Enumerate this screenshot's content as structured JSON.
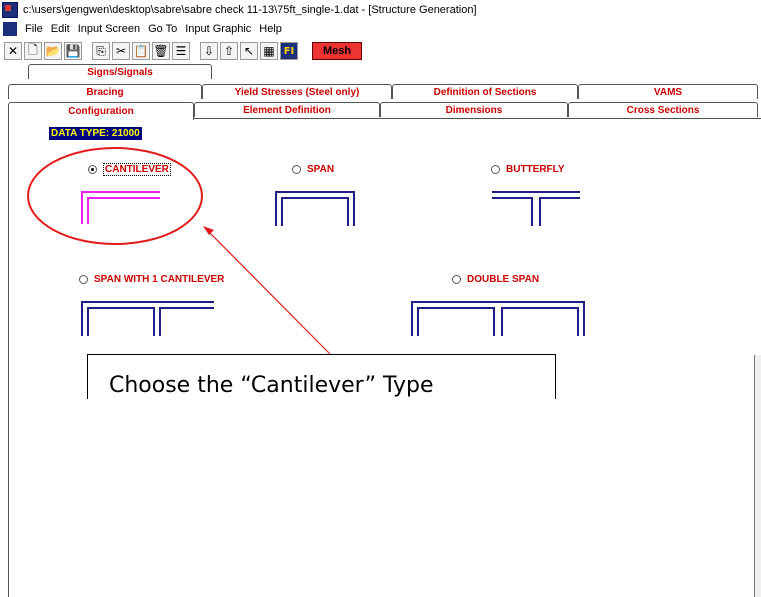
{
  "window": {
    "title": "c:\\users\\gengwen\\desktop\\sabre\\sabre check 11-13\\75ft_single-1.dat - [Structure Generation]"
  },
  "menu": [
    "File",
    "Edit",
    "Input Screen",
    "Go To",
    "Input Graphic",
    "Help"
  ],
  "toolbar": {
    "icons": [
      "close-x",
      "new-file",
      "open-folder",
      "save-disk",
      "copy",
      "cut",
      "paste",
      "delete",
      "sort",
      "arrow-down",
      "arrow-up",
      "pointer-help",
      "grid",
      "fi"
    ],
    "fi_label": "FI",
    "mesh_label": "Mesh"
  },
  "tabs": {
    "row1": [
      "Signs/Signals"
    ],
    "row2": [
      "Bracing",
      "Yield Stresses (Steel only)",
      "Definition of Sections",
      "VAMS"
    ],
    "row3": [
      "Configuration",
      "Element Definition",
      "Dimensions",
      "Cross Sections"
    ],
    "active": "Configuration"
  },
  "panel": {
    "data_type": "DATA TYPE: 21000",
    "options": [
      {
        "label": "CANTILEVER",
        "selected": true
      },
      {
        "label": "SPAN",
        "selected": false
      },
      {
        "label": "BUTTERFLY",
        "selected": false
      },
      {
        "label": "SPAN WITH 1 CANTILEVER",
        "selected": false
      },
      {
        "label": "DOUBLE SPAN",
        "selected": false
      }
    ]
  },
  "annotation": {
    "callout_text": "Choose the “Cantilever” Type",
    "color": "#e31b1b"
  },
  "colors": {
    "structure": "#1f1f8a",
    "selected_structure": "#ee22ee",
    "label_red": "#cc0000",
    "datatype_bg": "#000080",
    "datatype_fg": "#ffff00"
  }
}
